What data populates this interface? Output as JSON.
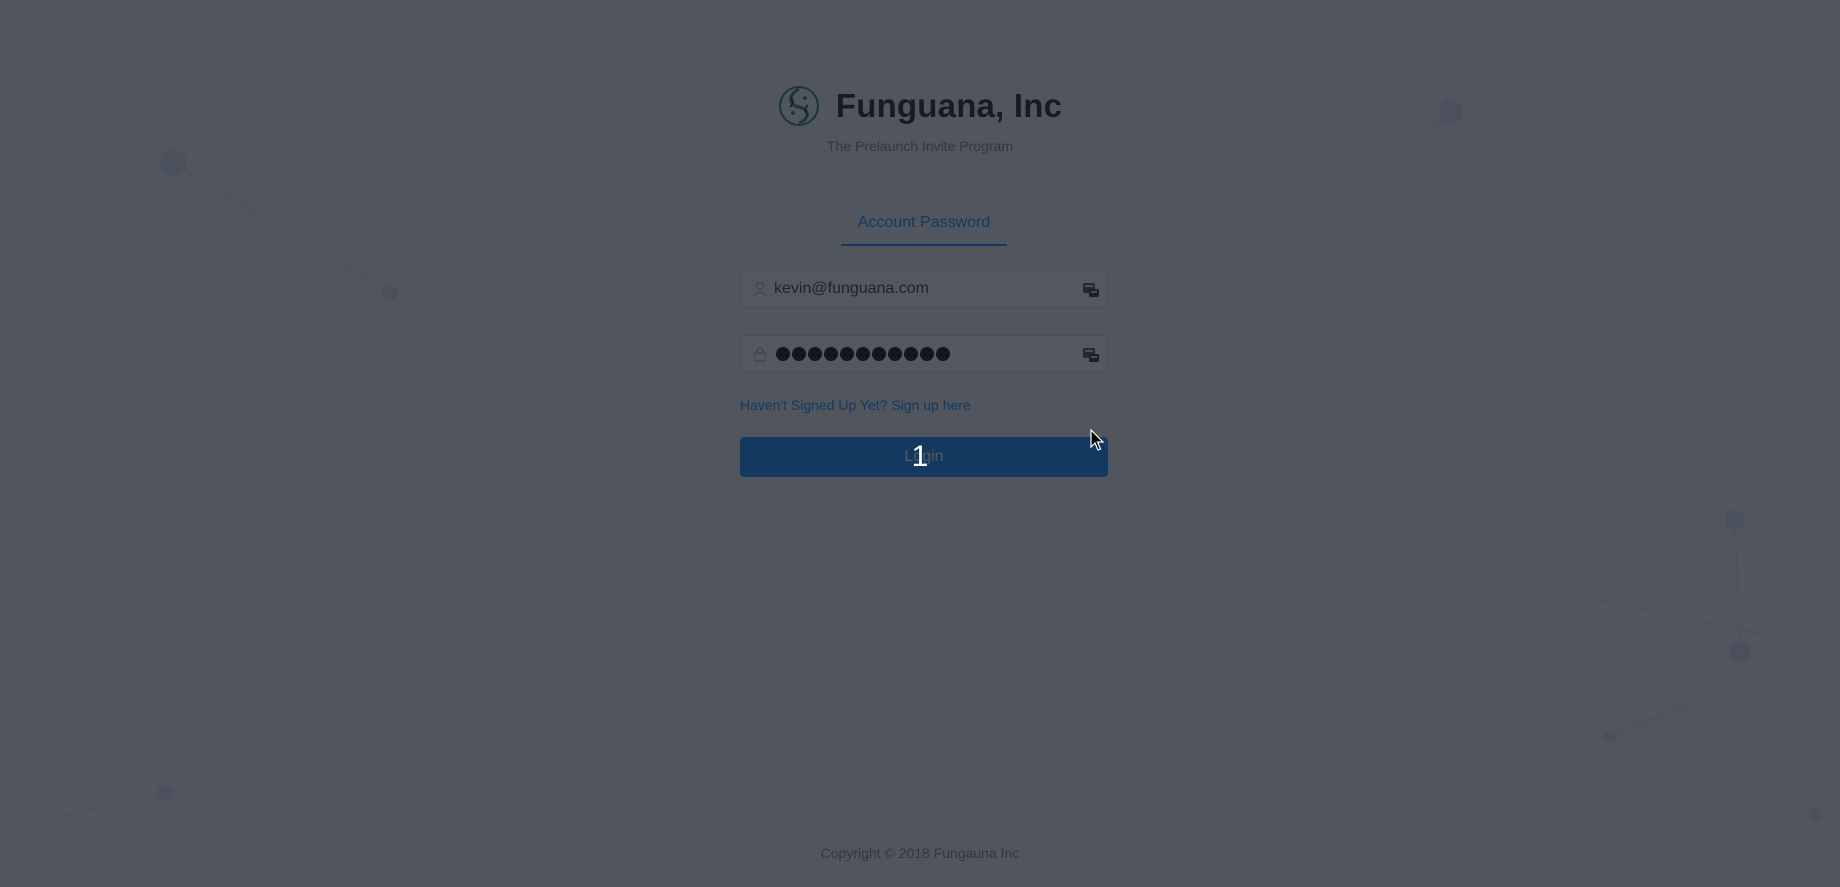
{
  "app": {
    "title": "Funguana, Inc",
    "subtitle": "The Prelaunch Invite Program",
    "logo_icon": "fungus-logo-icon"
  },
  "tabs": [
    {
      "label": "Account Password",
      "active": true
    }
  ],
  "form": {
    "email": {
      "value": "kevin@funguana.com",
      "prefix_icon": "user-icon",
      "suffix_icon": "autofill-key-icon"
    },
    "password": {
      "masked_length": 11,
      "prefix_icon": "lock-icon",
      "suffix_icon": "autofill-key-icon"
    },
    "signup_link": "Haven't Signed Up Yet? Sign up here",
    "login_button": "Login"
  },
  "footer": {
    "copyright": "Copyright © 2018 Fungauna Inc"
  },
  "overlay": {
    "step_number": "1"
  },
  "colors": {
    "primary": "#1890ff",
    "background": "#f0f2f5",
    "logo_green": "#2e8b57"
  }
}
